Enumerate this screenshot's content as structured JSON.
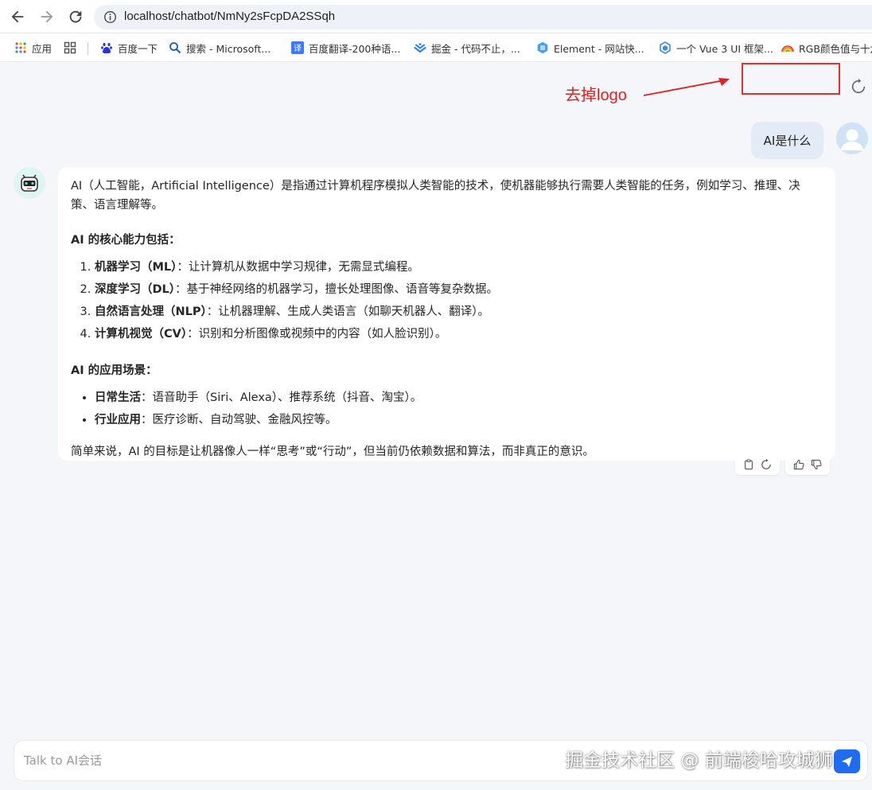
{
  "browser": {
    "url": "localhost/chatbot/NmNy2sFcpDA2SSqh"
  },
  "bookmarks": [
    {
      "label": "应用",
      "icon": "apps-grid-icon"
    },
    {
      "label": "百度一下",
      "icon": "baidu-icon"
    },
    {
      "label": "搜索 - Microsoft...",
      "icon": "search-icon"
    },
    {
      "label": "百度翻译-200种语...",
      "icon": "translate-icon"
    },
    {
      "label": "掘金 - 代码不止，...",
      "icon": "juejin-icon"
    },
    {
      "label": "Element - 网站快...",
      "icon": "element-icon"
    },
    {
      "label": "一个 Vue 3 UI 框架...",
      "icon": "vue-icon"
    },
    {
      "label": "RGB颜色值与十六",
      "icon": "rainbow-icon"
    }
  ],
  "annotation": {
    "text": "去掉logo",
    "color": "#e02020"
  },
  "chat": {
    "user_message": "AI是什么",
    "bot": {
      "intro": "AI（人工智能，Artificial Intelligence）是指通过计算机程序模拟人类智能的技术，使机器能够执行需要人类智能的任务，例如学习、推理、决策、语言理解等。",
      "core_heading": "AI 的核心能力包括：",
      "core_items": [
        {
          "term": "机器学习（ML）",
          "desc": "：让计算机从数据中学习规律，无需显式编程。"
        },
        {
          "term": "深度学习（DL）",
          "desc": "：基于神经网络的机器学习，擅长处理图像、语音等复杂数据。"
        },
        {
          "term": "自然语言处理（NLP）",
          "desc": "：让机器理解、生成人类语言（如聊天机器人、翻译）。"
        },
        {
          "term": "计算机视觉（CV）",
          "desc": "：识别和分析图像或视频中的内容（如人脸识别）。"
        }
      ],
      "app_heading": "AI 的应用场景：",
      "app_items": [
        {
          "term": "日常生活",
          "desc": "：语音助手（Siri、Alexa）、推荐系统（抖音、淘宝）。"
        },
        {
          "term": "行业应用",
          "desc": "：医疗诊断、自动驾驶、金融风控等。"
        }
      ],
      "summary": "简单来说，AI 的目标是让机器像人一样“思考”或“行动”，但当前仍依赖数据和算法，而非真正的意识。"
    }
  },
  "input": {
    "placeholder": "Talk to AI会话"
  },
  "watermark": "掘金技术社区 @ 前端梭哈攻城狮",
  "colors": {
    "accent": "#1f6cf0",
    "user_bubble": "#e3ebf6",
    "annotation_red": "#e63030"
  }
}
